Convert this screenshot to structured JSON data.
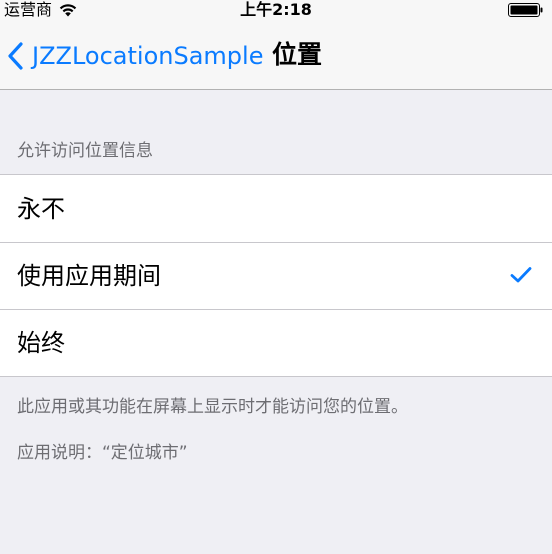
{
  "status_bar": {
    "carrier": "运营商",
    "time": "上午2:18",
    "icons": [
      "wifi-icon",
      "battery-icon"
    ]
  },
  "nav": {
    "back_label": "JZZLocationSample",
    "title": "位置",
    "accent_color": "#0a7bff"
  },
  "section": {
    "header": "允许访问位置信息",
    "options": [
      {
        "label": "永不",
        "selected": false
      },
      {
        "label": "使用应用期间",
        "selected": true
      },
      {
        "label": "始终",
        "selected": false
      }
    ]
  },
  "footer": {
    "note": "此应用或其功能在屏幕上显示时才能访问您的位置。",
    "usage": "应用说明：“定位城市”"
  }
}
